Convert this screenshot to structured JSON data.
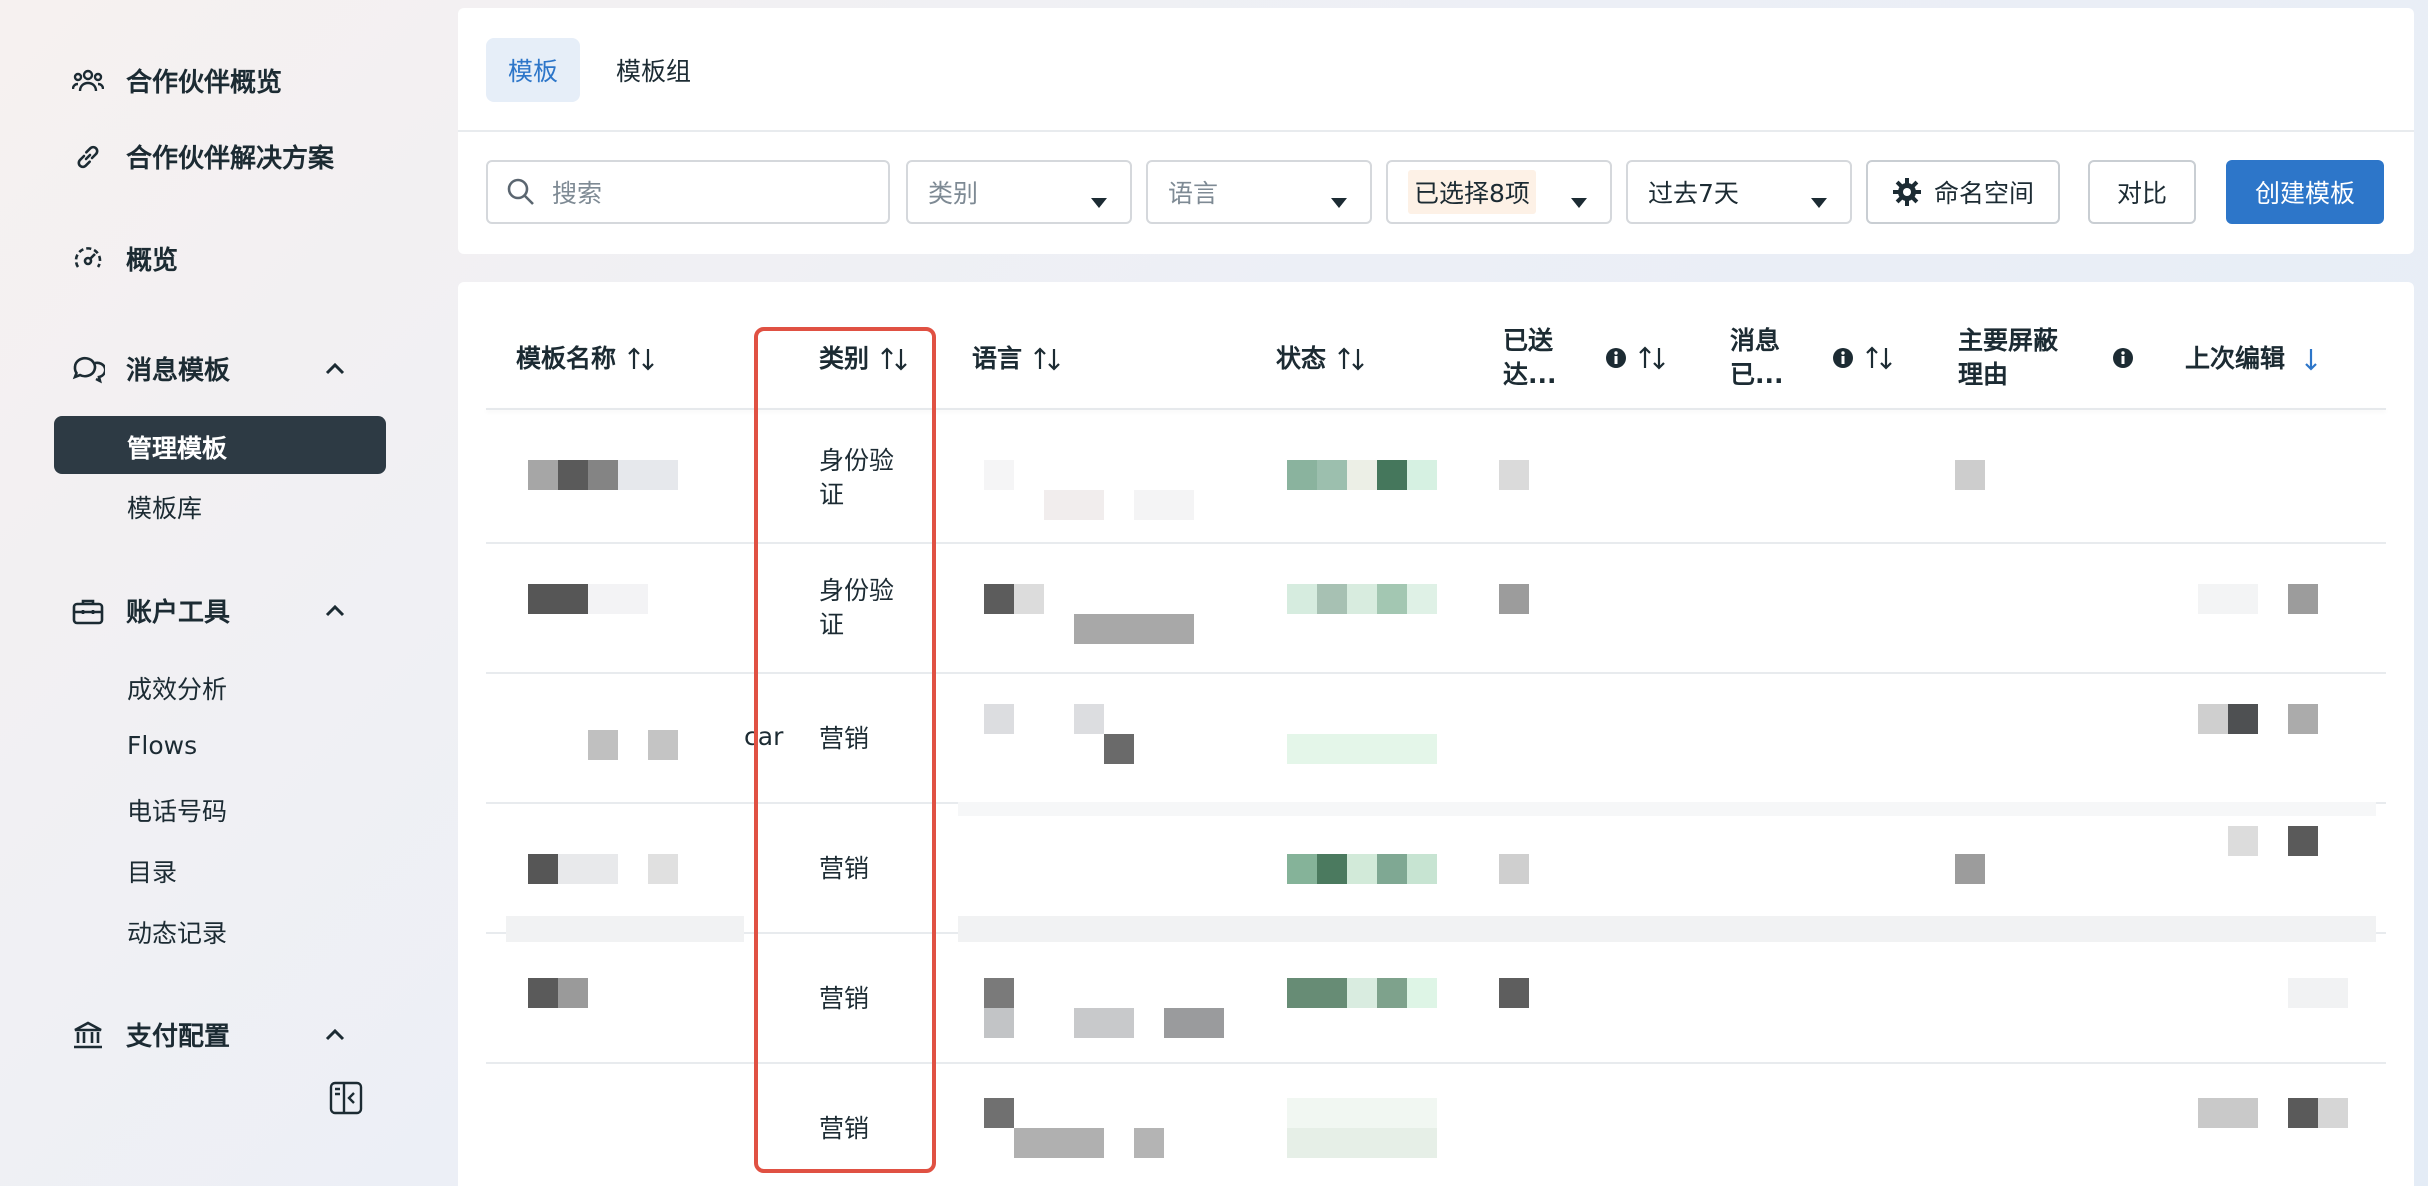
{
  "sidebar": {
    "items": [
      {
        "label": "合作伙伴概览",
        "icon": "people-group-icon"
      },
      {
        "label": "合作伙伴解决方案",
        "icon": "link-icon"
      },
      {
        "label": "概览",
        "icon": "gauge-icon"
      },
      {
        "label": "消息模板",
        "icon": "chat-bubbles-icon"
      },
      {
        "label": "账户工具",
        "icon": "briefcase-icon"
      },
      {
        "label": "支付配置",
        "icon": "bank-icon"
      }
    ],
    "message_templates_children": [
      "管理模板",
      "模板库"
    ],
    "account_tools_children": [
      "成效分析",
      "Flows",
      "电话号码",
      "目录",
      "动态记录"
    ],
    "active_item": "管理模板"
  },
  "tabs": {
    "template": "模板",
    "template_group": "模板组",
    "active": "模板"
  },
  "filters": {
    "search_placeholder": "搜索",
    "category_placeholder": "类别",
    "language_placeholder": "语言",
    "status_selected": "已选择8项",
    "time_range": "过去7天"
  },
  "buttons": {
    "namespace": "命名空间",
    "compare": "对比",
    "create": "创建模板"
  },
  "table": {
    "columns": {
      "name": "模板名称",
      "category": "类别",
      "language": "语言",
      "status": "状态",
      "delivered_l1": "已送",
      "delivered_l2": "达...",
      "read_l1": "消息",
      "read_l2": "已...",
      "blocked_l1": "主要屏蔽",
      "blocked_l2": "理由",
      "last_edited": "上次编辑"
    },
    "categories": [
      {
        "l1": "身份验",
        "l2": "证"
      },
      {
        "l1": "身份验",
        "l2": "证"
      },
      {
        "l1": "营销",
        "l2": ""
      },
      {
        "l1": "营销",
        "l2": ""
      },
      {
        "l1": "营销",
        "l2": ""
      },
      {
        "l1": "营销",
        "l2": ""
      }
    ],
    "name_fragment": "carib"
  },
  "colors": {
    "accent": "#2d76c9",
    "highlight": "#e05143",
    "sidebar_active": "#2d3a44"
  }
}
